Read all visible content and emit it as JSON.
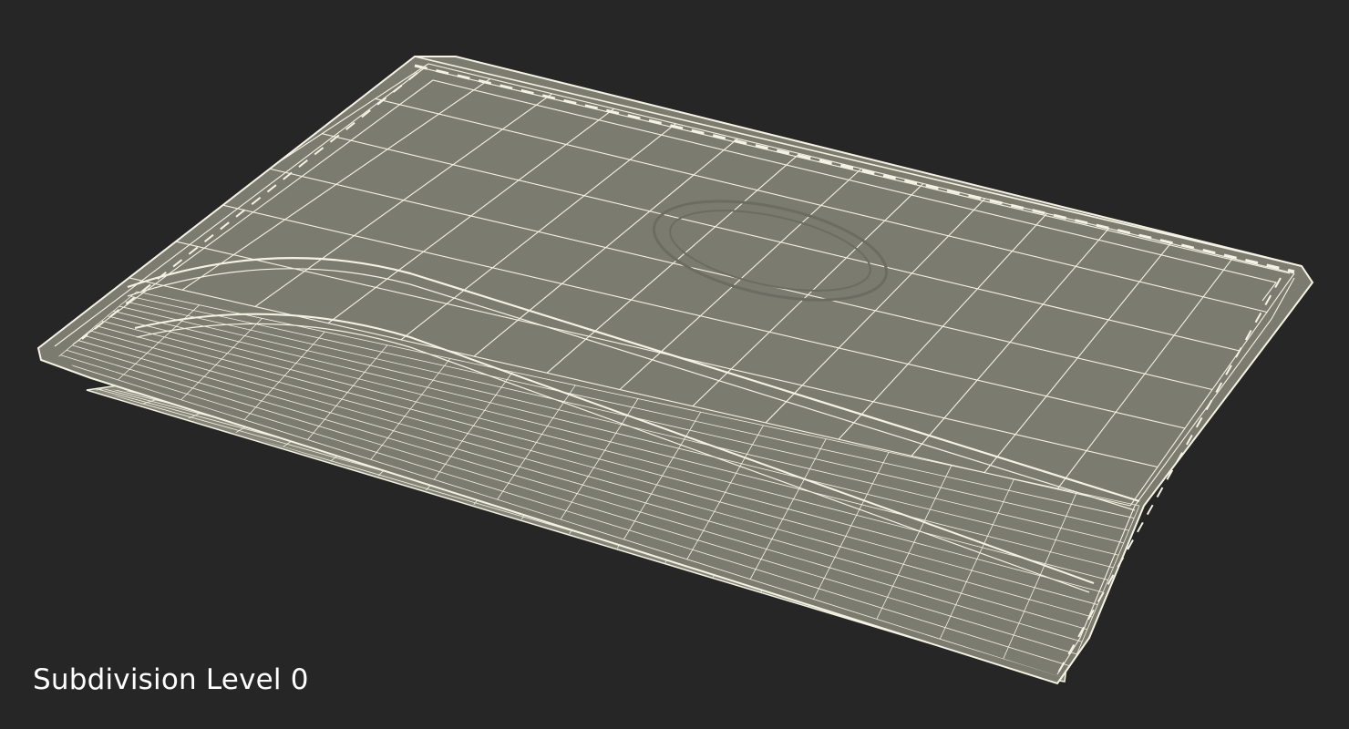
{
  "caption": {
    "text": "Subdivision Level 0"
  },
  "render": {
    "subject": "card-holder-wireframe",
    "background_color": "#262626",
    "surface_color": "#7b7b70",
    "wire_color": "#f4f2e2"
  }
}
